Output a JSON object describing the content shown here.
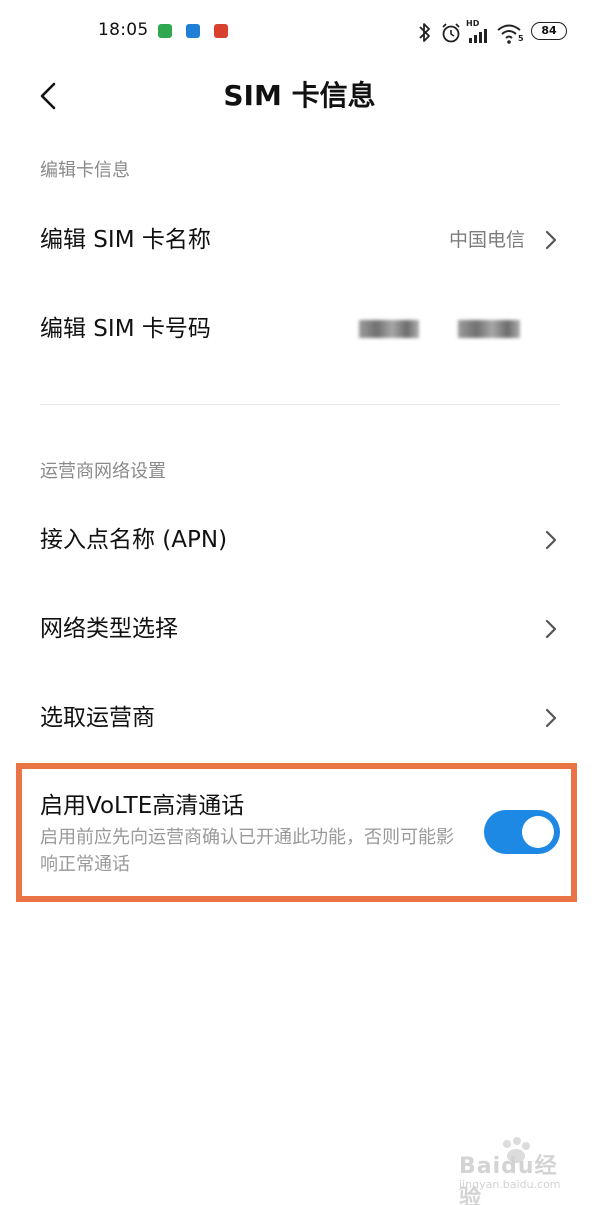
{
  "status_bar": {
    "time": "18:05",
    "battery": "84",
    "hd_label": "HD",
    "wifi_badge": "5"
  },
  "header": {
    "title": "SIM 卡信息"
  },
  "sections": {
    "card_info": {
      "header": "编辑卡信息",
      "edit_name": {
        "label": "编辑 SIM 卡名称",
        "value": "中国电信"
      },
      "edit_number": {
        "label": "编辑 SIM 卡号码"
      }
    },
    "carrier_network": {
      "header": "运营商网络设置",
      "apn": {
        "label": "接入点名称 (APN)"
      },
      "network_type": {
        "label": "网络类型选择"
      },
      "select_carrier": {
        "label": "选取运营商"
      }
    }
  },
  "volte": {
    "title": "启用VoLTE高清通话",
    "description": "启用前应先向运营商确认已开通此功能，否则可能影响正常通话",
    "enabled": true
  },
  "watermark": {
    "main": "Baidu经验",
    "sub": "jingyan.baidu.com"
  },
  "colors": {
    "accent_toggle": "#1e88e5",
    "highlight_border": "#ea7446",
    "secondary_text": "#8a8a8a"
  }
}
